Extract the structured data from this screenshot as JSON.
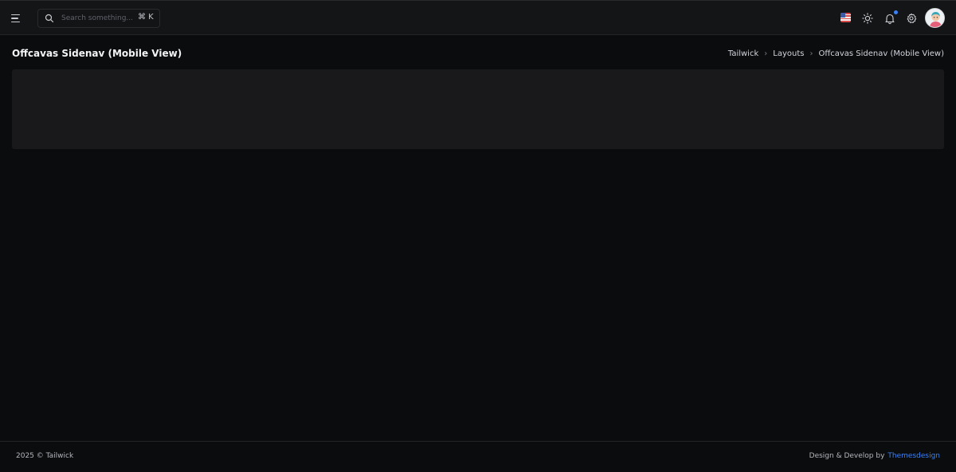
{
  "topbar": {
    "search_placeholder": "Search something...",
    "search_shortcut": "⌘ K",
    "icons": [
      "menu-icon",
      "search-icon",
      "us-flag-icon",
      "sun-icon",
      "bell-icon",
      "gear-icon",
      "avatar"
    ],
    "notification_dot_color": "#3b82f6"
  },
  "page": {
    "title": "Offcavas Sidenav (Mobile View)",
    "breadcrumb": [
      "Tailwick",
      "Layouts",
      "Offcavas Sidenav (Mobile View)"
    ]
  },
  "footer": {
    "copyright": "2025 © Tailwick",
    "credit_prefix": "Design & Develop by",
    "credit_link": "Themesdesign",
    "link_color": "#3b82f6"
  },
  "colors": {
    "background": "#0b0c0e",
    "topbar": "#141517",
    "card": "#19191b",
    "accent": "#3b82f6"
  }
}
